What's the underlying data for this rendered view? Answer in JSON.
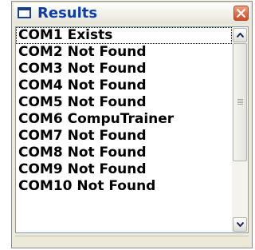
{
  "window": {
    "title": "Results",
    "title_icon": "window-icon",
    "close_icon": "close-icon",
    "accent_color": "#0b3ea8"
  },
  "list": {
    "items": [
      {
        "label": "COM1 Exists",
        "selected": true
      },
      {
        "label": "COM2 Not Found",
        "selected": false
      },
      {
        "label": "COM3 Not Found",
        "selected": false
      },
      {
        "label": "COM4 Not Found",
        "selected": false
      },
      {
        "label": "COM5 Not Found",
        "selected": false
      },
      {
        "label": "COM6 CompuTrainer",
        "selected": false
      },
      {
        "label": "COM7 Not Found",
        "selected": false
      },
      {
        "label": "COM8 Not Found",
        "selected": false
      },
      {
        "label": "COM9 Not Found",
        "selected": false
      },
      {
        "label": "COM10 Not Found",
        "selected": false
      }
    ]
  },
  "scrollbar": {
    "up_icon": "arrow-up-icon",
    "down_icon": "arrow-down-icon",
    "position": 0
  }
}
